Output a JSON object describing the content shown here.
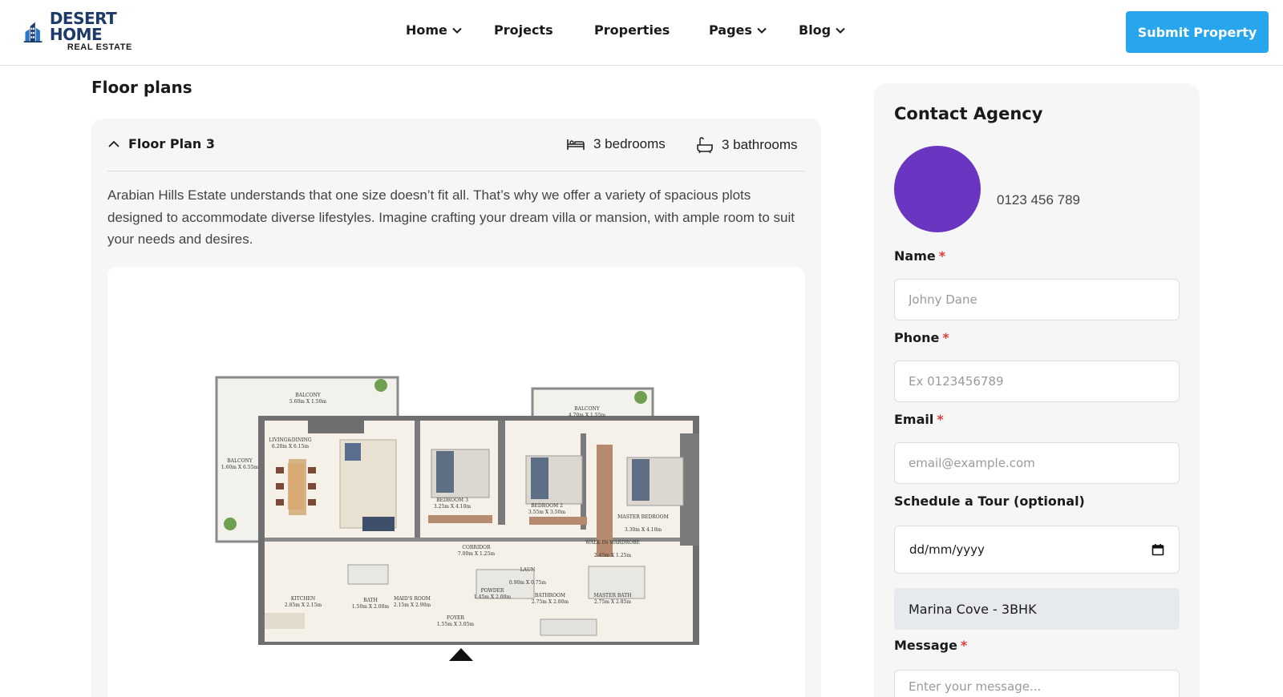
{
  "brand": {
    "name_line1": "DESERT HOME",
    "name_line2": "REAL ESTATE",
    "logo_color": "#1d3a6b"
  },
  "nav": {
    "items": [
      {
        "label": "Home",
        "has_dropdown": true
      },
      {
        "label": "Projects",
        "has_dropdown": false
      },
      {
        "label": "Properties",
        "has_dropdown": false
      },
      {
        "label": "Pages",
        "has_dropdown": true
      },
      {
        "label": "Blog",
        "has_dropdown": true
      }
    ],
    "cta_label": "Submit Property",
    "cta_color": "#27a6ee"
  },
  "floor_plans": {
    "title": "Floor plans",
    "plan": {
      "name": "Floor Plan 3",
      "expanded": true,
      "bedrooms": "3 bedrooms",
      "bathrooms": "3 bathrooms",
      "description": "Arabian Hills Estate understands that one size doesn’t fit all. That’s why we offer a variety of spacious plots designed to accommodate diverse lifestyles. Imagine crafting your dream villa or mansion, with ample room to suit your needs and desires.",
      "rooms": [
        {
          "name": "BALCONY",
          "size": "5.60m X 1.50m"
        },
        {
          "name": "BALCONY",
          "size": "4.70m X 1.55m"
        },
        {
          "name": "BALCONY",
          "size": "1.60m X 6.55m"
        },
        {
          "name": "LIVING&DINING",
          "size": "6.20m X 6.15m"
        },
        {
          "name": "BEDROOM 3",
          "size": "3.25m X 4.10m"
        },
        {
          "name": "BEDROOM 2",
          "size": "3.55m X 3.50m"
        },
        {
          "name": "MASTER BEDROOM",
          "size": "3.30m X 4.10m"
        },
        {
          "name": "CORRIDOR",
          "size": "7.00m X 1.25m"
        },
        {
          "name": "WALK IN WARDROBE",
          "size": "2.45m X 1.25m"
        },
        {
          "name": "LAUN",
          "size": "0.90m X 0.75m"
        },
        {
          "name": "KITCHEN",
          "size": "2.85m X 2.15m"
        },
        {
          "name": "BATH",
          "size": "1.50m X 2.00m"
        },
        {
          "name": "MAID'S ROOM",
          "size": "2.15m X 2.90m"
        },
        {
          "name": "FOYER",
          "size": "1.55m X 3.05m"
        },
        {
          "name": "POWDER",
          "size": "1.45m X 2.00m"
        },
        {
          "name": "BATHROOM",
          "size": "2.75m X 2.80m"
        },
        {
          "name": "MASTER BATH",
          "size": "2.75m X 2.85m"
        }
      ]
    }
  },
  "contact": {
    "title": "Contact Agency",
    "phone": "0123 456 789",
    "avatar_color": "#6a35c0",
    "fields": {
      "name_label": "Name",
      "name_placeholder": "Johny Dane",
      "phone_label": "Phone",
      "phone_placeholder": "Ex 0123456789",
      "email_label": "Email",
      "email_placeholder": "email@example.com",
      "tour_label": "Schedule a Tour (optional)",
      "tour_value": "dd/mm/yyyy",
      "property_value": "Marina Cove - 3BHK",
      "message_label": "Message",
      "message_placeholder": "Enter your message..."
    },
    "required_marker": "*"
  }
}
